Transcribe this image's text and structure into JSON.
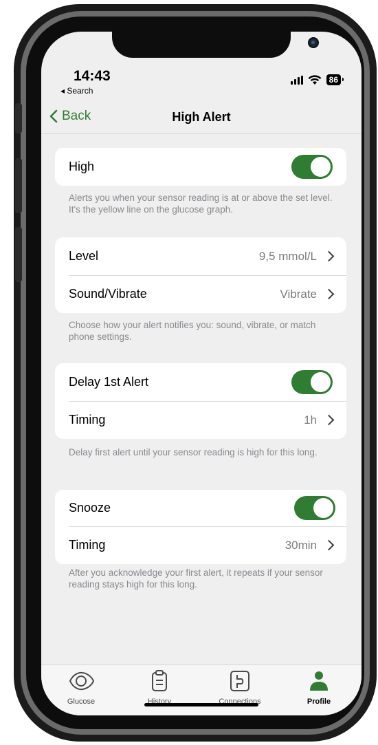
{
  "status_bar": {
    "time": "14:43",
    "back_app": "◂ Search",
    "battery": "86"
  },
  "nav": {
    "back_label": "Back",
    "title": "High Alert"
  },
  "high_group": {
    "label": "High",
    "enabled": true
  },
  "high_footnote": "Alerts you when your sensor reading is at or above the set level. It's the yellow line on the glucose graph.",
  "level_group": {
    "level_label": "Level",
    "level_value": "9,5 mmol/L",
    "sound_label": "Sound/Vibrate",
    "sound_value": "Vibrate"
  },
  "sound_footnote": "Choose how your alert notifies you: sound, vibrate, or match phone settings.",
  "delay_group": {
    "delay_label": "Delay 1st Alert",
    "delay_enabled": true,
    "timing_label": "Timing",
    "timing_value": "1h"
  },
  "delay_footnote": "Delay first alert until your sensor reading is high for this long.",
  "snooze_group": {
    "snooze_label": "Snooze",
    "snooze_enabled": true,
    "timing_label": "Timing",
    "timing_value": "30min"
  },
  "snooze_footnote": "After you acknowledge your first alert, it repeats if your sensor reading stays high for this long.",
  "tabs": [
    {
      "label": "Glucose",
      "icon": "glucose-icon",
      "active": false
    },
    {
      "label": "History",
      "icon": "clipboard-icon",
      "active": false
    },
    {
      "label": "Connections",
      "icon": "connections-icon",
      "active": false
    },
    {
      "label": "Profile",
      "icon": "profile-icon",
      "active": true
    }
  ],
  "colors": {
    "accent": "#2f7d32",
    "background": "#efeff0",
    "secondary_text": "#8a8a8f"
  }
}
